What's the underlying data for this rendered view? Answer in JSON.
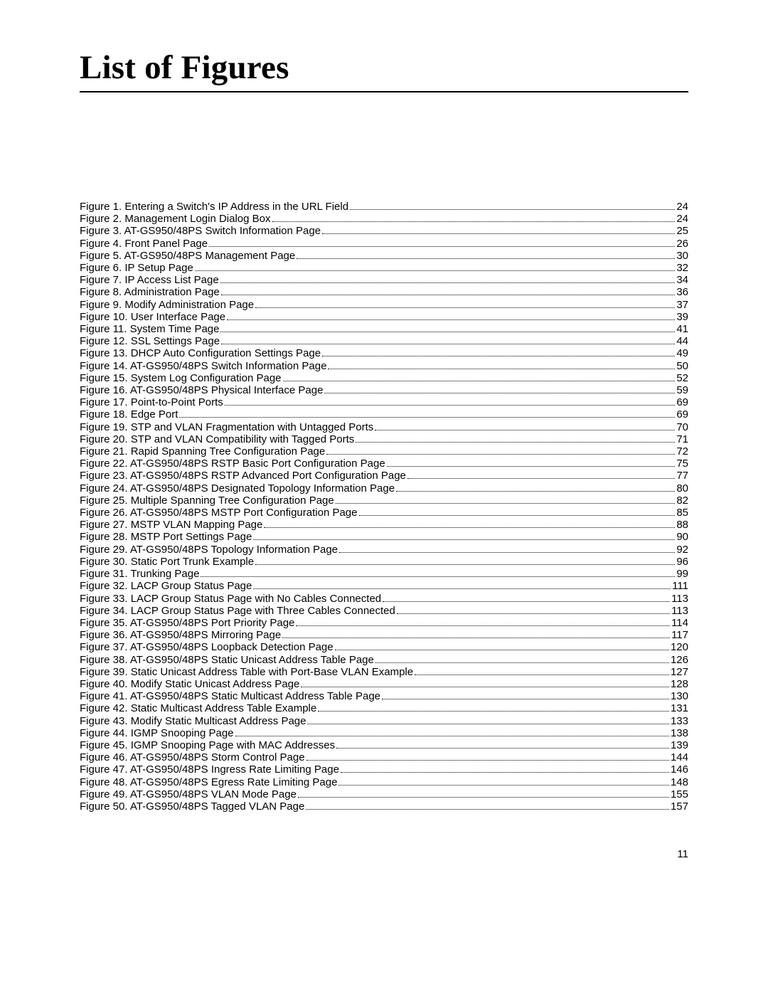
{
  "title": "List of Figures",
  "page_number": "11",
  "figures": [
    {
      "label": "Figure 1.  Entering a Switch's IP Address in the URL Field",
      "page": "24"
    },
    {
      "label": "Figure 2.  Management Login Dialog Box",
      "page": "24"
    },
    {
      "label": "Figure 3.  AT-GS950/48PS Switch Information Page",
      "page": "25"
    },
    {
      "label": "Figure 4.  Front Panel Page",
      "page": "26"
    },
    {
      "label": "Figure 5.  AT-GS950/48PS Management Page",
      "page": "30"
    },
    {
      "label": "Figure 6.  IP Setup Page",
      "page": "32"
    },
    {
      "label": "Figure 7.  IP Access List Page",
      "page": "34"
    },
    {
      "label": "Figure 8.  Administration Page",
      "page": "36"
    },
    {
      "label": "Figure 9.  Modify Administration Page",
      "page": "37"
    },
    {
      "label": "Figure 10.  User Interface Page",
      "page": "39"
    },
    {
      "label": "Figure 11.  System Time Page",
      "page": "41"
    },
    {
      "label": "Figure 12.  SSL Settings Page",
      "page": "44"
    },
    {
      "label": "Figure 13.  DHCP Auto Configuration Settings Page",
      "page": "49"
    },
    {
      "label": "Figure 14.  AT-GS950/48PS Switch Information Page",
      "page": "50"
    },
    {
      "label": "Figure 15.  System Log Configuration Page",
      "page": "52"
    },
    {
      "label": "Figure 16.  AT-GS950/48PS Physical Interface Page",
      "page": "59"
    },
    {
      "label": "Figure 17.  Point-to-Point Ports",
      "page": "69"
    },
    {
      "label": "Figure 18.  Edge Port",
      "page": "69"
    },
    {
      "label": "Figure 19.  STP and VLAN Fragmentation with Untagged Ports",
      "page": "70"
    },
    {
      "label": "Figure 20.  STP and VLAN Compatibility with Tagged Ports",
      "page": "71"
    },
    {
      "label": "Figure 21.  Rapid Spanning Tree Configuration Page",
      "page": "72"
    },
    {
      "label": "Figure 22.  AT-GS950/48PS RSTP Basic Port Configuration Page",
      "page": "75"
    },
    {
      "label": "Figure 23.  AT-GS950/48PS RSTP Advanced Port Configuration Page",
      "page": "77"
    },
    {
      "label": "Figure 24.  AT-GS950/48PS Designated Topology Information Page",
      "page": "80"
    },
    {
      "label": "Figure 25.  Multiple Spanning Tree Configuration Page",
      "page": "82"
    },
    {
      "label": "Figure 26.  AT-GS950/48PS MSTP Port Configuration Page",
      "page": "85"
    },
    {
      "label": "Figure 27.  MSTP VLAN Mapping Page",
      "page": "88"
    },
    {
      "label": "Figure 28.  MSTP Port Settings Page",
      "page": "90"
    },
    {
      "label": "Figure 29.  AT-GS950/48PS Topology Information Page",
      "page": "92"
    },
    {
      "label": "Figure 30.  Static Port Trunk Example",
      "page": "96"
    },
    {
      "label": "Figure 31.  Trunking Page",
      "page": "99"
    },
    {
      "label": "Figure 32.  LACP Group Status Page",
      "page": "111"
    },
    {
      "label": "Figure 33.  LACP Group Status Page with No Cables Connected",
      "page": "113"
    },
    {
      "label": "Figure 34.  LACP Group Status Page with Three Cables Connected",
      "page": "113"
    },
    {
      "label": "Figure 35.  AT-GS950/48PS Port Priority Page",
      "page": "114"
    },
    {
      "label": "Figure 36.  AT-GS950/48PS Mirroring Page",
      "page": "117"
    },
    {
      "label": "Figure 37.  AT-GS950/48PS Loopback Detection Page",
      "page": "120"
    },
    {
      "label": "Figure 38.  AT-GS950/48PS Static Unicast Address Table Page",
      "page": "126"
    },
    {
      "label": "Figure 39.  Static Unicast Address Table with Port-Base VLAN Example",
      "page": "127"
    },
    {
      "label": "Figure 40.  Modify Static Unicast Address Page",
      "page": "128"
    },
    {
      "label": "Figure 41.  AT-GS950/48PS Static Multicast Address Table Page",
      "page": "130"
    },
    {
      "label": "Figure 42.  Static Multicast Address Table Example",
      "page": "131"
    },
    {
      "label": "Figure 43.  Modify Static Multicast Address Page",
      "page": "133"
    },
    {
      "label": "Figure 44.  IGMP Snooping Page",
      "page": "138"
    },
    {
      "label": "Figure 45.  IGMP Snooping Page with MAC Addresses",
      "page": "139"
    },
    {
      "label": "Figure 46.  AT-GS950/48PS Storm Control Page",
      "page": "144"
    },
    {
      "label": "Figure 47.  AT-GS950/48PS Ingress Rate Limiting Page",
      "page": "146"
    },
    {
      "label": "Figure 48.  AT-GS950/48PS Egress Rate Limiting Page",
      "page": "148"
    },
    {
      "label": "Figure 49.  AT-GS950/48PS VLAN Mode Page",
      "page": "155"
    },
    {
      "label": "Figure 50.  AT-GS950/48PS Tagged VLAN Page",
      "page": "157"
    }
  ]
}
